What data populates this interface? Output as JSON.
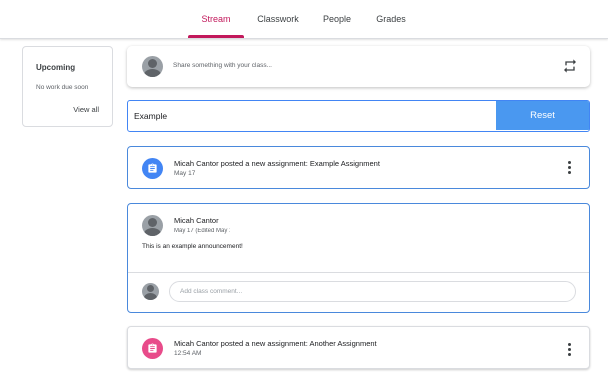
{
  "nav": {
    "tabs": [
      {
        "label": "Stream",
        "active": true
      },
      {
        "label": "Classwork",
        "active": false
      },
      {
        "label": "People",
        "active": false
      },
      {
        "label": "Grades",
        "active": false
      }
    ],
    "accent_color": "#c2185b"
  },
  "upcoming": {
    "title": "Upcoming",
    "empty_text": "No work due soon",
    "view_all": "View all"
  },
  "share": {
    "placeholder": "Share something with your class...",
    "avatar_icon": "person-avatar-icon",
    "action_icon": "repost-icon"
  },
  "filter": {
    "value": "Example",
    "reset_label": "Reset",
    "button_color": "#4a98f0"
  },
  "stream": [
    {
      "type": "assignment",
      "title": "Micah Cantor posted a new assignment: Example Assignment",
      "date": "May 17",
      "icon": "assignment-icon",
      "icon_color": "#4285f4"
    },
    {
      "type": "announcement",
      "author": "Micah Cantor",
      "date": "May 17 (Edited May 1",
      "message": "This is an example announcement!",
      "comment_placeholder": "Add class comment..."
    },
    {
      "type": "assignment",
      "title": "Micah Cantor posted a new assignment: Another Assignment",
      "date": "12:54 AM",
      "icon": "assignment-icon",
      "icon_color": "#e84b8a"
    }
  ]
}
